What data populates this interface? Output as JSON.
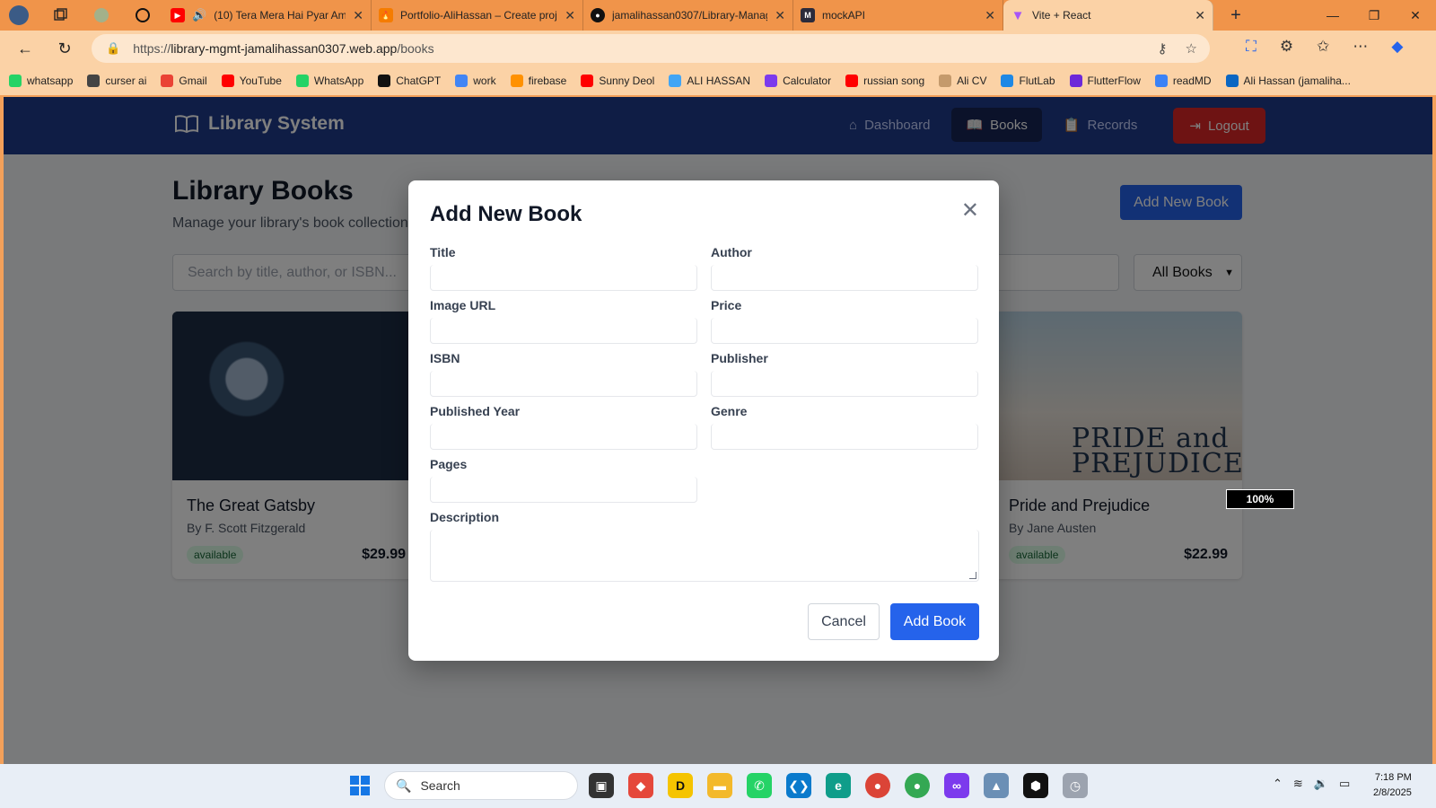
{
  "browser": {
    "tabs": [
      {
        "title": "(10) Tera Mera Hai Pyar Ama",
        "icon": "youtube-icon",
        "color": "#ff0000"
      },
      {
        "title": "Portfolio-AliHassan – Create proje",
        "icon": "firebase-icon",
        "color": "#f57c00"
      },
      {
        "title": "jamalihassan0307/Library-Manag",
        "icon": "github-icon",
        "color": "#111111"
      },
      {
        "title": "mockAPI",
        "icon": "mockapi-icon",
        "color": "#2b2b3b"
      },
      {
        "title": "Vite + React",
        "icon": "vite-icon",
        "color": "#a855f7"
      }
    ],
    "url_scheme": "https://",
    "url_host": "library-mgmt-jamalihassan0307.web.app",
    "url_path": "/books",
    "bookmarks": [
      {
        "label": "whatsapp",
        "color": "#25d366"
      },
      {
        "label": "curser ai",
        "color": "#444444"
      },
      {
        "label": "Gmail",
        "color": "#ea4335"
      },
      {
        "label": "YouTube",
        "color": "#ff0000"
      },
      {
        "label": "WhatsApp",
        "color": "#25d366"
      },
      {
        "label": "ChatGPT",
        "color": "#111111"
      },
      {
        "label": "work",
        "color": "#4285f4"
      },
      {
        "label": "firebase",
        "color": "#ff9100"
      },
      {
        "label": "Sunny Deol",
        "color": "#ff0000"
      },
      {
        "label": "ALI HASSAN",
        "color": "#42a5f5"
      },
      {
        "label": "Calculator",
        "color": "#7c3aed"
      },
      {
        "label": "russian song",
        "color": "#ff0000"
      },
      {
        "label": "Ali CV",
        "color": "#c49a6c"
      },
      {
        "label": "FlutLab",
        "color": "#1e88e5"
      },
      {
        "label": "FlutterFlow",
        "color": "#6d28d9"
      },
      {
        "label": "readMD",
        "color": "#3b82f6"
      },
      {
        "label": "Ali Hassan (jamaliha...",
        "color": "#0a66c2"
      }
    ]
  },
  "app": {
    "brand": "Library System",
    "nav": [
      {
        "label": "Dashboard",
        "icon": "home-icon"
      },
      {
        "label": "Books",
        "icon": "book-icon"
      },
      {
        "label": "Records",
        "icon": "clipboard-icon"
      }
    ],
    "logout": "Logout",
    "page_title": "Library Books",
    "page_subtitle": "Manage your library's book collection",
    "add_new_button": "Add New Book",
    "search_placeholder": "Search by title, author, or ISBN...",
    "filter_value": "All Books",
    "books": [
      {
        "title": "The Great Gatsby",
        "author": "By F. Scott Fitzgerald",
        "status": "available",
        "price": "$29.99"
      },
      {
        "title": "Pride and Prejudice",
        "author": "By Jane Austen",
        "status": "available",
        "price": "$22.99",
        "cover_text": "PRIDE and PREJUDICE"
      }
    ],
    "zoom_overlay": "100%"
  },
  "modal": {
    "title": "Add New Book",
    "fields": [
      "Title",
      "Author",
      "Image URL",
      "Price",
      "ISBN",
      "Publisher",
      "Published Year",
      "Genre",
      "Pages"
    ],
    "description_label": "Description",
    "cancel": "Cancel",
    "submit": "Add Book"
  },
  "taskbar": {
    "search": "Search",
    "time": "7:18 PM",
    "date": "2/8/2025"
  },
  "colors": {
    "nav_bg": "#1e3a8a",
    "primary": "#2563eb",
    "logout": "#dc2626",
    "chrome": "#f0944a"
  }
}
